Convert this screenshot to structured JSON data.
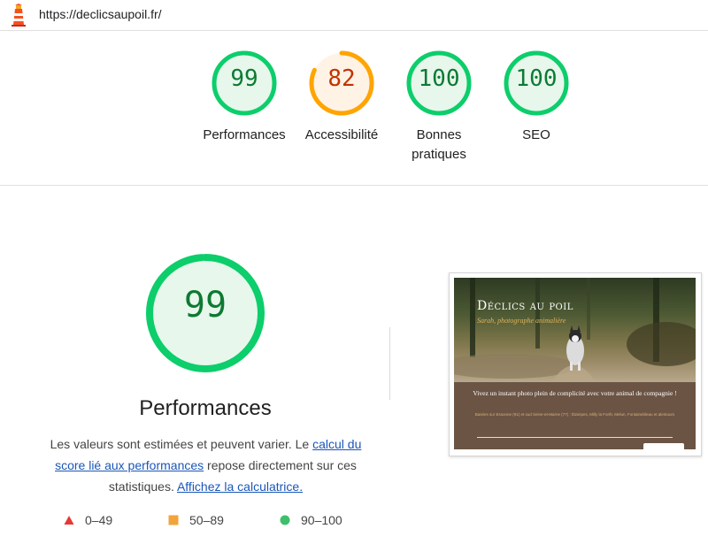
{
  "header": {
    "url": "https://declicsaupoil.fr/",
    "logo_icon": "lighthouse-icon"
  },
  "summary": [
    {
      "label": "Performances",
      "score": "99",
      "value": 99,
      "color": "#0cce6b",
      "text_color": "#0d7a33",
      "fill": "#e7f7ec"
    },
    {
      "label": "Accessibilité",
      "score": "82",
      "value": 82,
      "color": "#ffa400",
      "text_color": "#c33300",
      "fill": "#fff3e6"
    },
    {
      "label": "Bonnes pratiques",
      "score": "100",
      "value": 100,
      "color": "#0cce6b",
      "text_color": "#0d7a33",
      "fill": "#e7f7ec"
    },
    {
      "label": "SEO",
      "score": "100",
      "value": 100,
      "color": "#0cce6b",
      "text_color": "#0d7a33",
      "fill": "#e7f7ec"
    }
  ],
  "main": {
    "score": "99",
    "value": 99,
    "title": "Performances",
    "desc_before": "Les valeurs sont estimées et peuvent varier. Le ",
    "desc_link1": "calcul du score lié aux performances",
    "desc_middle": " repose directement sur ces statistiques. ",
    "desc_link2": "Affichez la calculatrice."
  },
  "legend": [
    {
      "range": "0–49",
      "icon": "triangle-icon",
      "color": "#e53935"
    },
    {
      "range": "50–89",
      "icon": "square-icon",
      "color": "#f2a33a"
    },
    {
      "range": "90–100",
      "icon": "circle-icon",
      "color": "#3fbf6b"
    }
  ],
  "thumbnail": {
    "site_title": "Déclics au poil",
    "site_subtitle": "Sarah, photographe animalière",
    "headline": "Vivez un instant photo plein de complicité avec votre animal de compagnie !",
    "small_text": "Basées sur Essonne (91) et sud Seine-et-Marne (77) : Étampes, Milly la Forêt, Melun, Fontainebleau et alentours"
  }
}
